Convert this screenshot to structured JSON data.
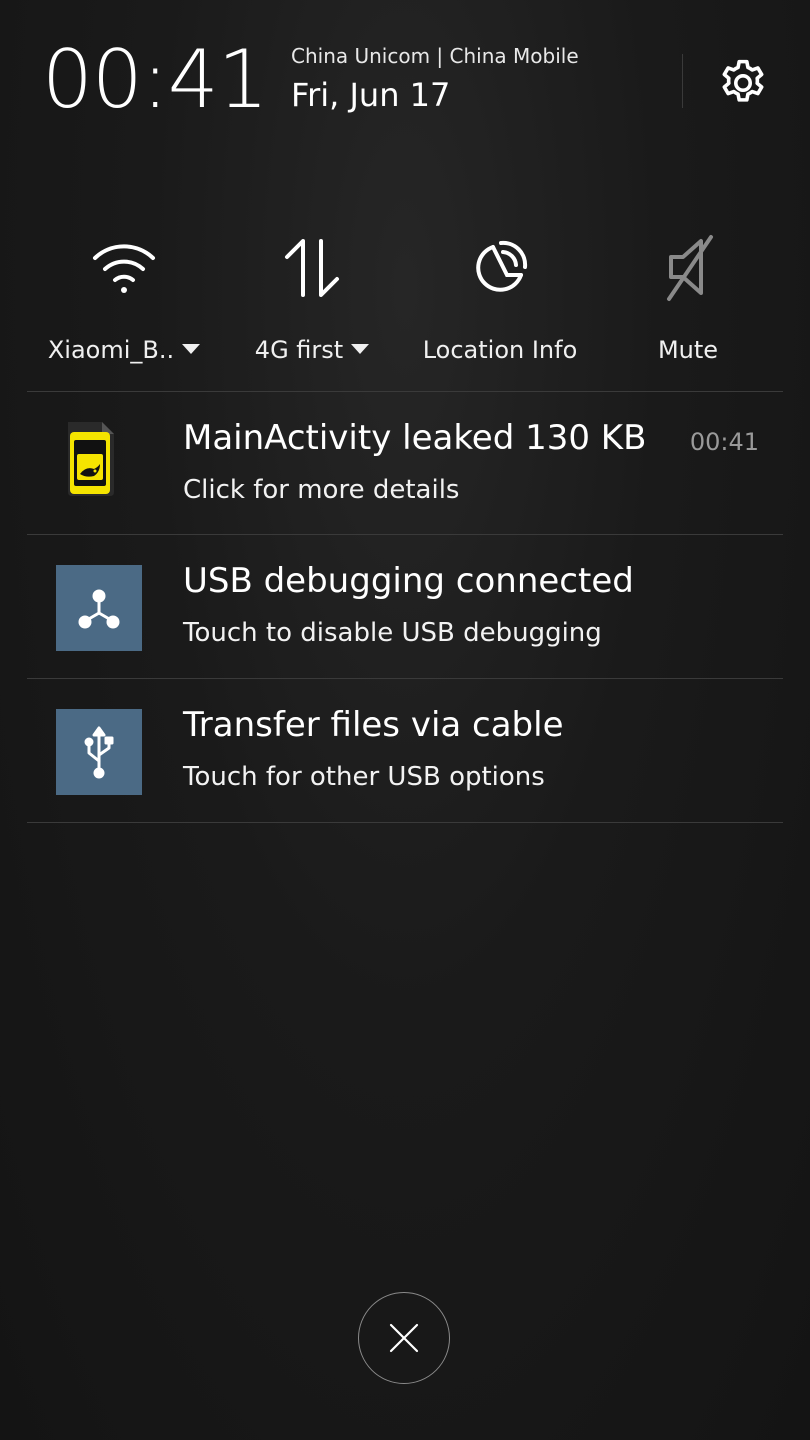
{
  "header": {
    "time": "00:41",
    "carrier": "China Unicom | China Mobile",
    "date": "Fri, Jun 17",
    "settings_icon": "gear-icon"
  },
  "toggles": [
    {
      "icon": "wifi-icon",
      "label": "Xiaomi_B..",
      "has_dropdown": true
    },
    {
      "icon": "data-arrows-icon",
      "label": "4G first",
      "has_dropdown": true
    },
    {
      "icon": "location-icon",
      "label": "Location Info",
      "has_dropdown": false
    },
    {
      "icon": "mute-icon",
      "label": "Mute",
      "has_dropdown": false
    }
  ],
  "notifications": [
    {
      "icon": "leakcanary-icon",
      "title": "MainActivity leaked 130 KB",
      "subtitle": "Click for more details",
      "time": "00:41"
    },
    {
      "icon": "usb-debug-icon",
      "title": "USB debugging connected",
      "subtitle": "Touch to disable USB debugging",
      "time": ""
    },
    {
      "icon": "usb-icon",
      "title": "Transfer files via cable",
      "subtitle": "Touch for other USB options",
      "time": ""
    }
  ],
  "colors": {
    "background": "#151515",
    "usb_tile": "#4b6a85",
    "leak_icon_yellow": "#f5e400",
    "divider": "#3a3a3a"
  },
  "close_icon": "close-icon"
}
